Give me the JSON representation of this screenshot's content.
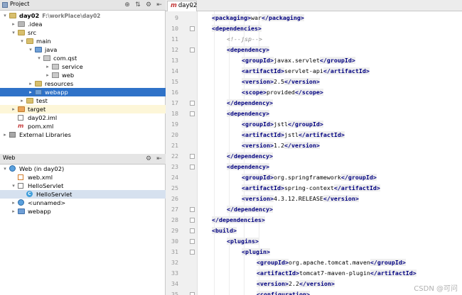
{
  "project_panel": {
    "title": "Project",
    "tree": [
      {
        "label": "day02",
        "bold": true,
        "path": "F:\\workPlace\\day02",
        "arrow": "▾",
        "icon": "folder",
        "indent": 0
      },
      {
        "label": ".idea",
        "arrow": "▸",
        "icon": "folder grey",
        "indent": 1
      },
      {
        "label": "src",
        "arrow": "▾",
        "icon": "folder",
        "indent": 1
      },
      {
        "label": "main",
        "arrow": "▾",
        "icon": "folder",
        "indent": 2
      },
      {
        "label": "java",
        "arrow": "▾",
        "icon": "folder blue",
        "indent": 3
      },
      {
        "label": "com.qst",
        "arrow": "▾",
        "icon": "pkg",
        "indent": 4
      },
      {
        "label": "service",
        "arrow": "▸",
        "icon": "pkg",
        "indent": 5
      },
      {
        "label": "web",
        "arrow": "▸",
        "icon": "pkg",
        "indent": 5
      },
      {
        "label": "resources",
        "arrow": "▸",
        "icon": "folder",
        "indent": 3
      },
      {
        "label": "webapp",
        "arrow": "▸",
        "icon": "folder blue",
        "indent": 3,
        "selected": true
      },
      {
        "label": "test",
        "arrow": "▸",
        "icon": "folder",
        "indent": 2
      },
      {
        "label": "target",
        "arrow": "▸",
        "icon": "folder orange",
        "indent": 1,
        "highlight": true
      },
      {
        "label": "day02.iml",
        "arrow": "",
        "icon": "file",
        "indent": 1
      },
      {
        "label": "pom.xml",
        "arrow": "",
        "icon": "mvn",
        "indent": 1
      },
      {
        "label": "External Libraries",
        "arrow": "▸",
        "icon": "libs",
        "indent": 0
      }
    ]
  },
  "web_panel": {
    "title": "Web",
    "tree": [
      {
        "label": "Web (in day02)",
        "arrow": "▾",
        "icon": "webico",
        "indent": 0
      },
      {
        "label": "web.xml",
        "arrow": "",
        "icon": "file xml",
        "indent": 1
      },
      {
        "label": "HelloServlet",
        "arrow": "▾",
        "icon": "file",
        "indent": 1
      },
      {
        "label": "HelloServlet",
        "arrow": "",
        "icon": "cls",
        "indent": 2,
        "selected_light": true
      },
      {
        "label": "<unnamed>",
        "arrow": "▸",
        "icon": "webico",
        "indent": 1
      },
      {
        "label": "webapp",
        "arrow": "▸",
        "icon": "folder blue",
        "indent": 1
      }
    ]
  },
  "editor": {
    "tab_icon": "m",
    "tab_label": "day02",
    "tab_close": "×",
    "lines": [
      {
        "n": "9",
        "indent": 1,
        "tokens": [
          [
            "tg",
            "<packaging>"
          ],
          [
            "tx",
            "war"
          ],
          [
            "tg",
            "</packaging>"
          ]
        ]
      },
      {
        "n": "10",
        "indent": 1,
        "tokens": [
          [
            "tg",
            "<dependencies>"
          ]
        ],
        "fold": true
      },
      {
        "n": "11",
        "indent": 2,
        "tokens": [
          [
            "cm",
            "<!--jsp-->"
          ]
        ]
      },
      {
        "n": "12",
        "indent": 2,
        "tokens": [
          [
            "tg",
            "<dependency>"
          ]
        ],
        "fold": true
      },
      {
        "n": "13",
        "indent": 3,
        "tokens": [
          [
            "tg",
            "<groupId>"
          ],
          [
            "tx",
            "javax.servlet"
          ],
          [
            "tg",
            "</groupId>"
          ]
        ]
      },
      {
        "n": "14",
        "indent": 3,
        "tokens": [
          [
            "tg",
            "<artifactId>"
          ],
          [
            "tx",
            "servlet-api"
          ],
          [
            "tg",
            "</artifactId>"
          ]
        ]
      },
      {
        "n": "15",
        "indent": 3,
        "tokens": [
          [
            "tg",
            "<version>"
          ],
          [
            "tx",
            "2.5"
          ],
          [
            "tg",
            "</version>"
          ]
        ]
      },
      {
        "n": "16",
        "indent": 3,
        "tokens": [
          [
            "tg",
            "<scope>"
          ],
          [
            "tx",
            "provided"
          ],
          [
            "tg",
            "</scope>"
          ]
        ]
      },
      {
        "n": "17",
        "indent": 2,
        "tokens": [
          [
            "tg",
            "</dependency>"
          ]
        ],
        "fold": true
      },
      {
        "n": "18",
        "indent": 2,
        "tokens": [
          [
            "tg",
            "<dependency>"
          ]
        ],
        "fold": true
      },
      {
        "n": "19",
        "indent": 3,
        "tokens": [
          [
            "tg",
            "<groupId>"
          ],
          [
            "tx",
            "jstl"
          ],
          [
            "tg",
            "</groupId>"
          ]
        ]
      },
      {
        "n": "20",
        "indent": 3,
        "tokens": [
          [
            "tg",
            "<artifactId>"
          ],
          [
            "tx",
            "jstl"
          ],
          [
            "tg",
            "</artifactId>"
          ]
        ]
      },
      {
        "n": "21",
        "indent": 3,
        "tokens": [
          [
            "tg",
            "<version>"
          ],
          [
            "tx",
            "1.2"
          ],
          [
            "tg",
            "</version>"
          ]
        ]
      },
      {
        "n": "22",
        "indent": 2,
        "tokens": [
          [
            "tg",
            "</dependency>"
          ]
        ],
        "fold": true
      },
      {
        "n": "23",
        "indent": 2,
        "tokens": [
          [
            "tg",
            "<dependency>"
          ]
        ],
        "fold": true
      },
      {
        "n": "24",
        "indent": 3,
        "tokens": [
          [
            "tg",
            "<groupId>"
          ],
          [
            "tx",
            "org.springframework"
          ],
          [
            "tg",
            "</groupId>"
          ]
        ]
      },
      {
        "n": "25",
        "indent": 3,
        "tokens": [
          [
            "tg",
            "<artifactId>"
          ],
          [
            "tx",
            "spring-context"
          ],
          [
            "tg",
            "</artifactId>"
          ]
        ]
      },
      {
        "n": "26",
        "indent": 3,
        "tokens": [
          [
            "tg",
            "<version>"
          ],
          [
            "tx",
            "4.3.12.RELEASE"
          ],
          [
            "tg",
            "</version>"
          ]
        ]
      },
      {
        "n": "27",
        "indent": 2,
        "tokens": [
          [
            "tg",
            "</dependency>"
          ]
        ],
        "fold": true
      },
      {
        "n": "28",
        "indent": 1,
        "tokens": [
          [
            "tg",
            "</dependencies>"
          ]
        ],
        "fold": true
      },
      {
        "n": "29",
        "indent": 1,
        "tokens": [
          [
            "tg",
            "<build>"
          ]
        ],
        "fold": true
      },
      {
        "n": "30",
        "indent": 2,
        "tokens": [
          [
            "tg",
            "<plugins>"
          ]
        ],
        "fold": true
      },
      {
        "n": "31",
        "indent": 3,
        "tokens": [
          [
            "tg",
            "<plugin>"
          ]
        ],
        "fold": true
      },
      {
        "n": "32",
        "indent": 4,
        "tokens": [
          [
            "tg",
            "<groupId>"
          ],
          [
            "tx",
            "org.apache.tomcat.maven"
          ],
          [
            "tg",
            "</groupId>"
          ]
        ]
      },
      {
        "n": "33",
        "indent": 4,
        "tokens": [
          [
            "tg",
            "<artifactId>"
          ],
          [
            "tx",
            "tomcat7-maven-plugin"
          ],
          [
            "tg",
            "</artifactId>"
          ]
        ]
      },
      {
        "n": "34",
        "indent": 4,
        "tokens": [
          [
            "tg",
            "<version>"
          ],
          [
            "tx",
            "2.2"
          ],
          [
            "tg",
            "</version>"
          ]
        ]
      },
      {
        "n": "35",
        "indent": 4,
        "tokens": [
          [
            "tg",
            "<configuration>"
          ]
        ],
        "fold": true
      }
    ]
  },
  "watermark": "CSDN @可问"
}
